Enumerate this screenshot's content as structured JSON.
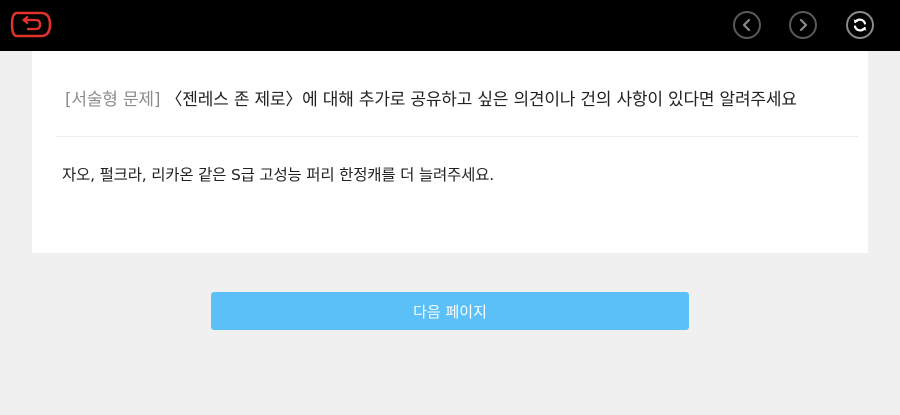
{
  "topbar": {
    "back_icon": "back-arrow-icon",
    "prev_icon": "chevron-left-icon",
    "next_icon": "chevron-right-icon",
    "refresh_icon": "refresh-icon",
    "back_color": "#e2322b"
  },
  "question": {
    "tag": "[서술형 문제]",
    "text": "〈젠레스 존 제로〉에 대해 추가로 공유하고 싶은 의견이나 건의 사항이 있다면 알려주세요"
  },
  "answer": {
    "text": "자오, 펄크라, 리카온 같은 S급 고성능 퍼리 한정캐를 더 늘려주세요."
  },
  "footer": {
    "next_page_label": "다음 페이지",
    "button_color": "#5bc0f8"
  }
}
